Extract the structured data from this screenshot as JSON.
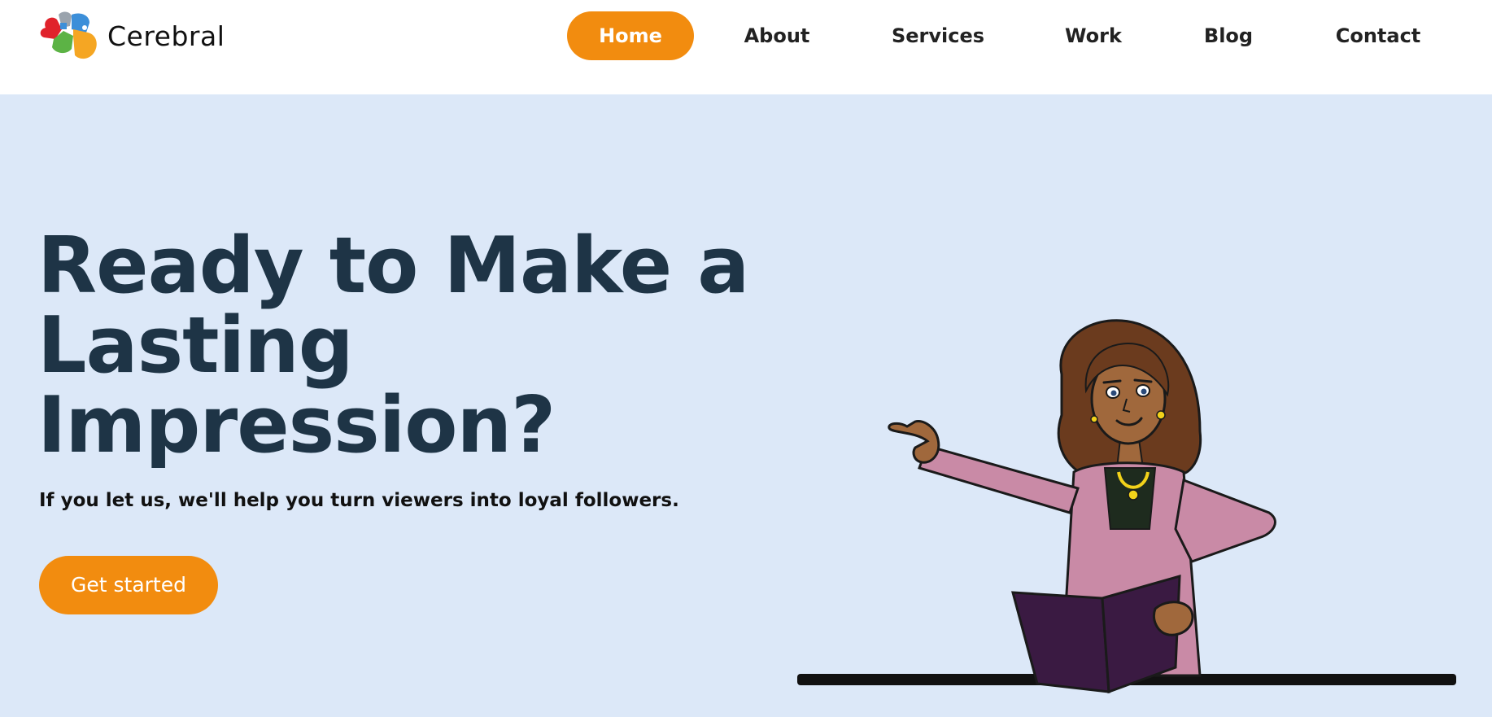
{
  "header": {
    "brand": "Cerebral"
  },
  "nav": {
    "items": [
      {
        "label": "Home",
        "active": true
      },
      {
        "label": "About",
        "active": false
      },
      {
        "label": "Services",
        "active": false
      },
      {
        "label": "Work",
        "active": false
      },
      {
        "label": "Blog",
        "active": false
      },
      {
        "label": "Contact",
        "active": false
      }
    ]
  },
  "hero": {
    "headline_line1": "Ready to Make a",
    "headline_line2": "Lasting",
    "headline_line3": "Impression?",
    "subheadline": "If you let us, we'll help you turn viewers into loyal followers.",
    "cta_label": "Get started"
  },
  "colors": {
    "accent": "#f28c0f",
    "hero_background": "#dce8f8",
    "headline": "#1e3446"
  },
  "icons": {
    "logo": "brain-puzzle-logo-icon",
    "illustration": "woman-pointing-with-book-illustration"
  }
}
